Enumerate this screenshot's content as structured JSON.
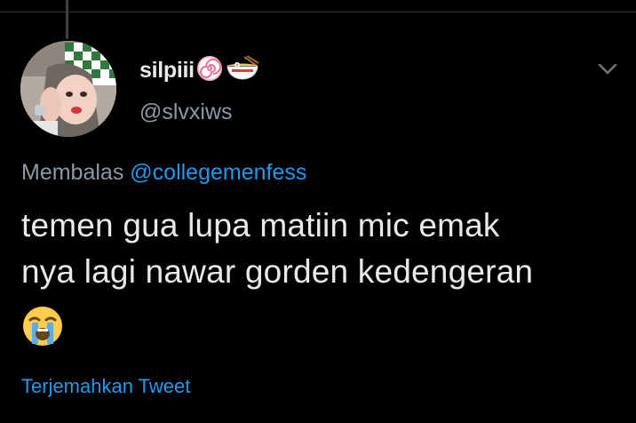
{
  "tweet": {
    "display_name": "silpiii",
    "name_emojis": [
      "narutomaki-emoji",
      "ramen-emoji"
    ],
    "handle": "@slvxiws",
    "reply_prefix": "Membalas",
    "reply_to": "@collegemenfess",
    "text_lines": [
      "temen gua lupa matiin mic emak",
      "nya lagi nawar gorden kedengeran"
    ],
    "trailing_emoji": "loudly-crying-face-emoji",
    "translate_label": "Terjemahkan Tweet"
  },
  "icons": {
    "more": "chevron-down-icon"
  },
  "colors": {
    "background": "#000000",
    "primary_text": "#e7e9ea",
    "secondary_text": "#8b98a5",
    "link": "#1d9bf0",
    "divider": "#2f3336"
  }
}
